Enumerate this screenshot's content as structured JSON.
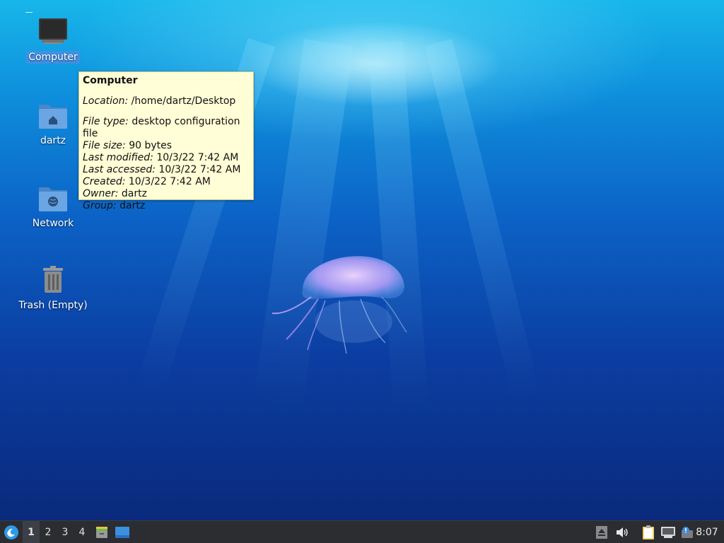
{
  "desktop": {
    "icons": [
      {
        "label": "Computer",
        "selected": true
      },
      {
        "label": "dartz"
      },
      {
        "label": "Network"
      },
      {
        "label": "Trash (Empty)"
      }
    ]
  },
  "tooltip": {
    "title": "Computer",
    "location_label": "Location:",
    "location_value": "/home/dartz/Desktop",
    "rows": [
      {
        "label": "File type:",
        "value": "desktop configuration file"
      },
      {
        "label": "File size:",
        "value": "90 bytes"
      },
      {
        "label": "Last modified:",
        "value": "10/3/22 7:42 AM"
      },
      {
        "label": "Last accessed:",
        "value": "10/3/22 7:42 AM"
      },
      {
        "label": "Created:",
        "value": "10/3/22 7:42 AM"
      },
      {
        "label": "Owner:",
        "value": "dartz"
      },
      {
        "label": "Group:",
        "value": "dartz"
      }
    ],
    "background": "#fffed6"
  },
  "taskbar": {
    "workspaces": [
      "1",
      "2",
      "3",
      "4"
    ],
    "active_workspace": "1",
    "icons": [
      "start-menu-icon",
      "file-manager-icon",
      "show-desktop-icon",
      "eject-icon",
      "volume-icon",
      "clipboard-icon",
      "network-icon",
      "notification-icon"
    ],
    "clock": "8:07",
    "accent": "#2e9ae6"
  }
}
